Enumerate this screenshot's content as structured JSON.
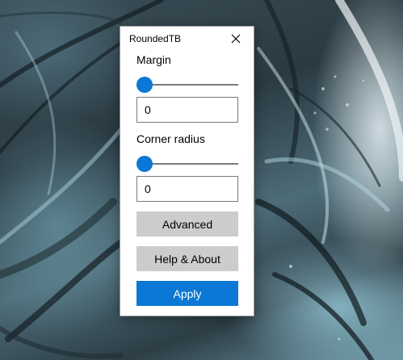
{
  "window": {
    "title": "RoundedTB"
  },
  "margin": {
    "label": "Margin",
    "slider_value": 0,
    "input_value": "0"
  },
  "corner_radius": {
    "label": "Corner radius",
    "slider_value": 0,
    "input_value": "0"
  },
  "buttons": {
    "advanced": "Advanced",
    "help_about": "Help & About",
    "apply": "Apply"
  },
  "icons": {
    "close": "close-icon"
  },
  "colors": {
    "accent": "#0a78d4",
    "button_gray": "#cccccc",
    "window_bg": "#ffffff"
  }
}
